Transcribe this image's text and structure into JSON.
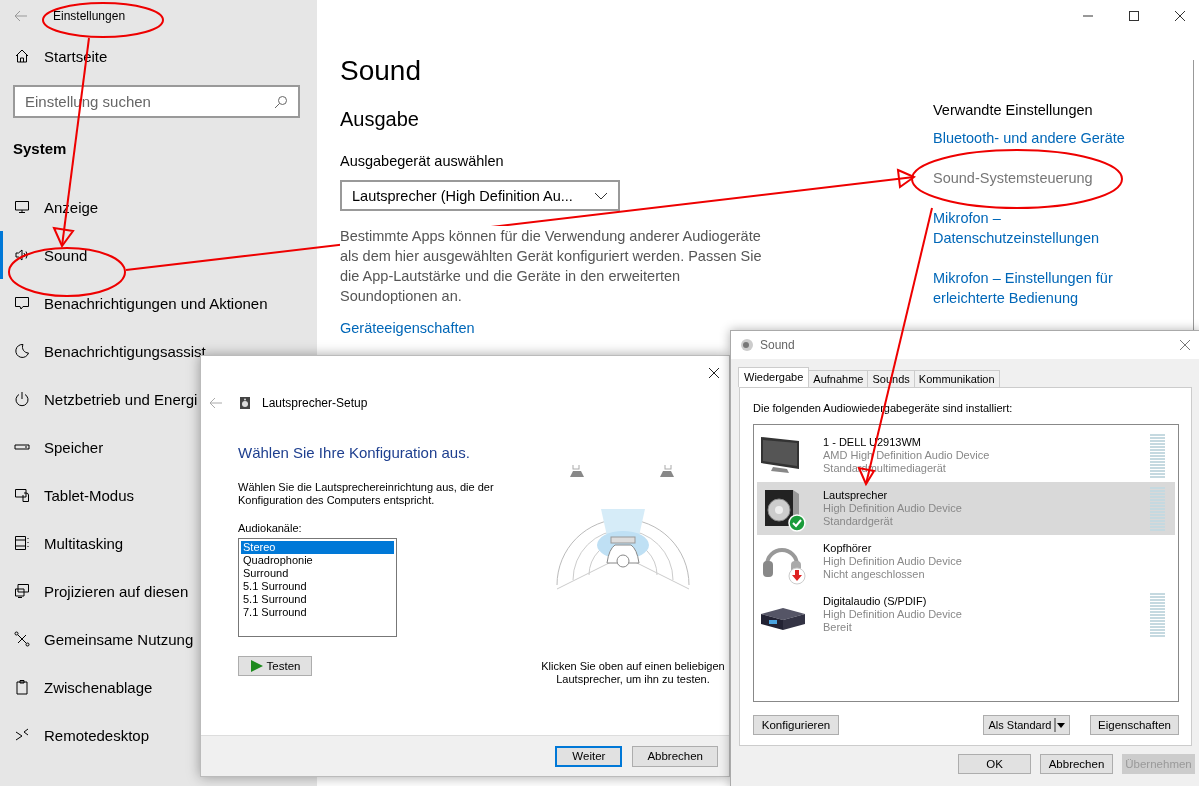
{
  "settings": {
    "app_title": "Einstellungen",
    "home": "Startseite",
    "search": {
      "placeholder": "Einstellung suchen"
    },
    "section": "System",
    "nav": [
      {
        "label": "Anzeige",
        "kind": "display",
        "selected": false
      },
      {
        "label": "Sound",
        "kind": "sound",
        "selected": true
      },
      {
        "label": "Benachrichtigungen und Aktionen",
        "kind": "notifications",
        "selected": false
      },
      {
        "label": "Benachrichtigungsassist",
        "kind": "moon",
        "selected": false
      },
      {
        "label": "Netzbetrieb und Energi",
        "kind": "power",
        "selected": false
      },
      {
        "label": "Speicher",
        "kind": "storage",
        "selected": false
      },
      {
        "label": "Tablet-Modus",
        "kind": "tablet",
        "selected": false
      },
      {
        "label": "Multitasking",
        "kind": "multitasking",
        "selected": false
      },
      {
        "label": "Projizieren auf diesen",
        "kind": "project",
        "selected": false
      },
      {
        "label": "Gemeinsame Nutzung",
        "kind": "share",
        "selected": false
      },
      {
        "label": "Zwischenablage",
        "kind": "clipboard",
        "selected": false
      },
      {
        "label": "Remotedesktop",
        "kind": "remote",
        "selected": false
      }
    ],
    "page": {
      "title": "Sound",
      "output_heading": "Ausgabe",
      "device_label": "Ausgabegerät auswählen",
      "device_value": "Lautsprecher (High Definition Au...",
      "description": "Bestimmte Apps können für die Verwendung anderer Audiogeräte als dem hier ausgewählten Gerät konfiguriert werden. Passen Sie die App-Lautstärke und die Geräte in den erweiterten Soundoptionen an.",
      "link": "Geräteeigenschaften"
    },
    "related": {
      "heading": "Verwandte Einstellungen",
      "links": [
        {
          "label": "Bluetooth- und andere Geräte",
          "hovered": false
        },
        {
          "label": "Sound-Systemsteuerung",
          "hovered": true
        },
        {
          "label": "Mikrofon – Datenschutzeinstellungen",
          "hovered": false
        },
        {
          "label": "Mikrofon – Einstellungen für erleichterte Bedienung",
          "hovered": false
        }
      ]
    }
  },
  "speaker_setup": {
    "title": "Lautsprecher-Setup",
    "heading": "Wählen Sie Ihre Konfiguration aus.",
    "description": "Wählen Sie die Lautsprechereinrichtung aus, die der Konfiguration des Computers entspricht.",
    "channels_label": "Audiokanäle:",
    "channels": [
      {
        "label": "Stereo",
        "selected": true
      },
      {
        "label": "Quadrophonie",
        "selected": false
      },
      {
        "label": "Surround",
        "selected": false
      },
      {
        "label": "5.1 Surround",
        "selected": false
      },
      {
        "label": "5.1 Surround",
        "selected": false
      },
      {
        "label": "7.1 Surround",
        "selected": false
      }
    ],
    "test_button": "Testen",
    "hint": "Klicken Sie oben auf einen beliebigen Lautsprecher, um ihn zu testen.",
    "buttons": [
      {
        "label": "Weiter",
        "default": true
      },
      {
        "label": "Abbrechen",
        "default": false
      }
    ]
  },
  "sound_dialog": {
    "title": "Sound",
    "tabs": [
      {
        "label": "Wiedergabe",
        "selected": true
      },
      {
        "label": "Aufnahme",
        "selected": false
      },
      {
        "label": "Sounds",
        "selected": false
      },
      {
        "label": "Kommunikation",
        "selected": false
      }
    ],
    "intro": "Die folgenden Audiowiedergabegeräte sind installiert:",
    "devices": [
      {
        "name": "1 - DELL U2913WM",
        "driver": "AMD High Definition Audio Device",
        "status": "Standardmultimediagerät",
        "kind": "monitor",
        "default_device": false,
        "unplugged": false,
        "meter": true,
        "selected": false
      },
      {
        "name": "Lautsprecher",
        "driver": "High Definition Audio Device",
        "status": "Standardgerät",
        "kind": "speaker",
        "default_device": true,
        "unplugged": false,
        "meter": true,
        "selected": true
      },
      {
        "name": "Kopfhörer",
        "driver": "High Definition Audio Device",
        "status": "Nicht angeschlossen",
        "kind": "headphones",
        "default_device": false,
        "unplugged": true,
        "meter": false,
        "selected": false
      },
      {
        "name": "Digitalaudio (S/PDIF)",
        "driver": "High Definition Audio Device",
        "status": "Bereit",
        "kind": "receiver",
        "default_device": false,
        "unplugged": false,
        "meter": true,
        "selected": false
      }
    ],
    "panel_buttons": [
      {
        "label": "Konfigurieren",
        "kind": "plain"
      },
      {
        "label": "Als Standard",
        "kind": "split"
      },
      {
        "label": "Eigenschaften",
        "kind": "plain"
      }
    ],
    "buttons": [
      {
        "label": "OK",
        "disabled": false
      },
      {
        "label": "Abbrechen",
        "disabled": false
      },
      {
        "label": "Übernehmen",
        "disabled": true
      }
    ]
  }
}
